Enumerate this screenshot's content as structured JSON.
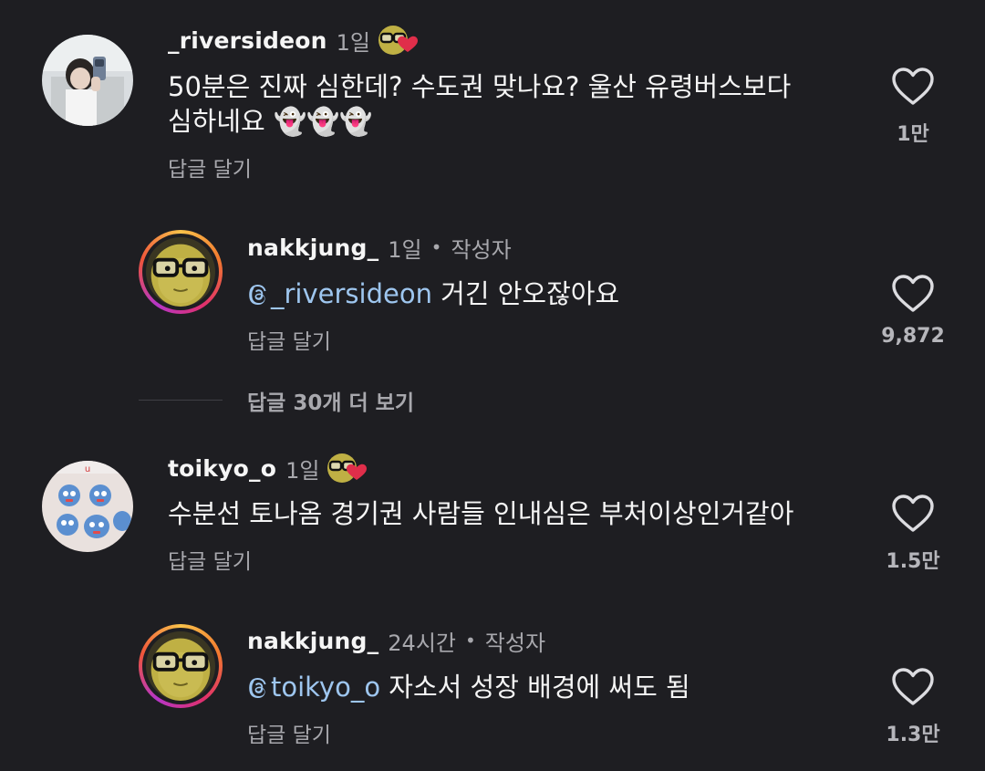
{
  "comments": [
    {
      "username": "_riversideon",
      "time": "1일",
      "line1": "50분은 진짜 심한데? 수도권 맞나요? 울산 유령버스보다",
      "line2": "심하네요 👻👻👻",
      "reply_label": "답글 달기",
      "likes": "1만",
      "avatar_icon": "selfie-avatar"
    },
    {
      "username": "nakkjung_",
      "time": "1일",
      "author_label": "작성자",
      "mention": "_riversideon",
      "text": " 거긴 안오잖아요",
      "reply_label": "답글 달기",
      "likes": "9,872",
      "avatar_icon": "glasses-character-avatar"
    },
    {
      "username": "toikyo_o",
      "time": "1일",
      "text": "수분선 토나옴 경기권 사람들 인내심은 부처이상인거같아",
      "reply_label": "답글 달기",
      "likes": "1.5만",
      "avatar_icon": "stickers-avatar"
    },
    {
      "username": "nakkjung_",
      "time": "24시간",
      "author_label": "작성자",
      "mention": "toikyo_o",
      "text": " 자소서 성장 배경에 써도 됨",
      "reply_label": "답글 달기",
      "likes": "1.3만",
      "avatar_icon": "glasses-character-avatar"
    }
  ],
  "more_replies": "답글 30개 더 보기",
  "colors": {
    "background": "#1e1e22",
    "text": "#f5f5f5",
    "muted": "#a8a8ad",
    "mention": "#9ec6ef",
    "like_heart": "#e02e4a"
  }
}
